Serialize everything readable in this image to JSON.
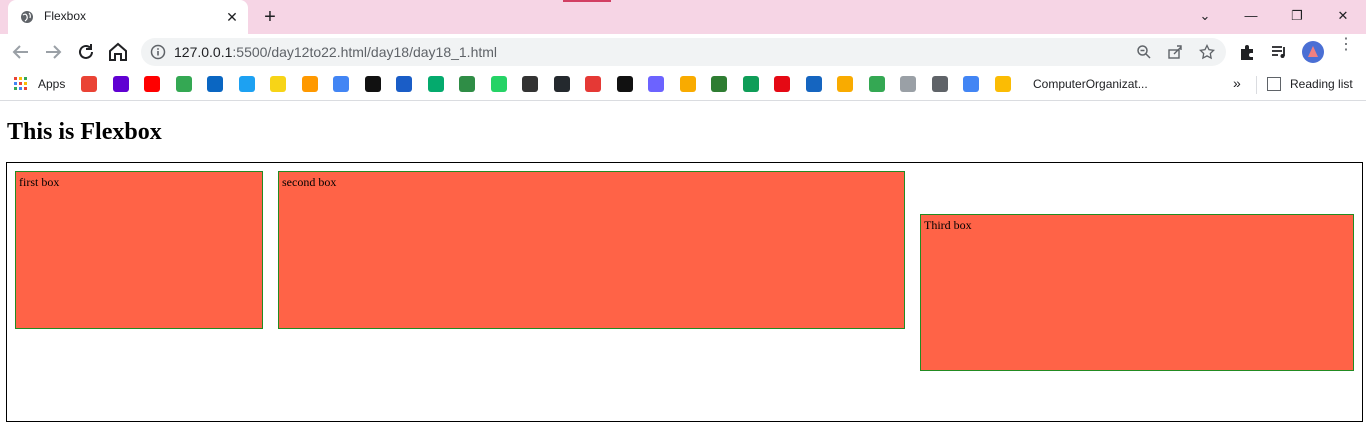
{
  "tab": {
    "title": "Flexbox",
    "close": "✕"
  },
  "new_tab": "+",
  "window_controls": {
    "dropdown": "⌄",
    "minimize": "—",
    "restore": "❐",
    "close": "✕"
  },
  "address_bar": {
    "host": "127.0.0.1",
    "rest": ":5500/day12to22.html/day18/day18_1.html"
  },
  "bookmarks": {
    "apps_label": "Apps",
    "items": [
      {
        "name": "gmail",
        "color": "#ea4335"
      },
      {
        "name": "yahoo-mail",
        "color": "#6001d2"
      },
      {
        "name": "youtube",
        "color": "#ff0000"
      },
      {
        "name": "maps",
        "color": "#34a853"
      },
      {
        "name": "linkedin",
        "color": "#0a66c2"
      },
      {
        "name": "twitter",
        "color": "#1da1f2"
      },
      {
        "name": "flipkart",
        "color": "#f7d417"
      },
      {
        "name": "amazon",
        "color": "#ff9900"
      },
      {
        "name": "google",
        "color": "#4285f4"
      },
      {
        "name": "bookmark-black",
        "color": "#111111"
      },
      {
        "name": "codechef",
        "color": "#1a5dc7"
      },
      {
        "name": "w3schools",
        "color": "#04aa6d"
      },
      {
        "name": "geeksforgeeks",
        "color": "#2f8d46"
      },
      {
        "name": "whatsapp",
        "color": "#25d366"
      },
      {
        "name": "graduation-cap",
        "color": "#333333"
      },
      {
        "name": "github",
        "color": "#24292e"
      },
      {
        "name": "lifebuoy",
        "color": "#e53935"
      },
      {
        "name": "hackerrank",
        "color": "#111111"
      },
      {
        "name": "code-editor",
        "color": "#6c63ff"
      },
      {
        "name": "classroom",
        "color": "#f9ab00"
      },
      {
        "name": "circle-green",
        "color": "#2e7d32"
      },
      {
        "name": "sheets",
        "color": "#0f9d58"
      },
      {
        "name": "netflix",
        "color": "#e50914"
      },
      {
        "name": "play",
        "color": "#1565c0"
      },
      {
        "name": "brackets",
        "color": "#f9ab00"
      },
      {
        "name": "drive",
        "color": "#34a853"
      },
      {
        "name": "page",
        "color": "#9aa0a6"
      },
      {
        "name": "shield",
        "color": "#5f6368"
      },
      {
        "name": "google-2",
        "color": "#4285f4"
      },
      {
        "name": "drive-2",
        "color": "#fbbc04"
      }
    ],
    "last_label": "ComputerOrganizat...",
    "more": "»",
    "reading_list": "Reading list"
  },
  "page": {
    "heading": "This is Flexbox",
    "boxes": [
      {
        "label": "first box"
      },
      {
        "label": "second box"
      },
      {
        "label": "Third box"
      }
    ]
  }
}
